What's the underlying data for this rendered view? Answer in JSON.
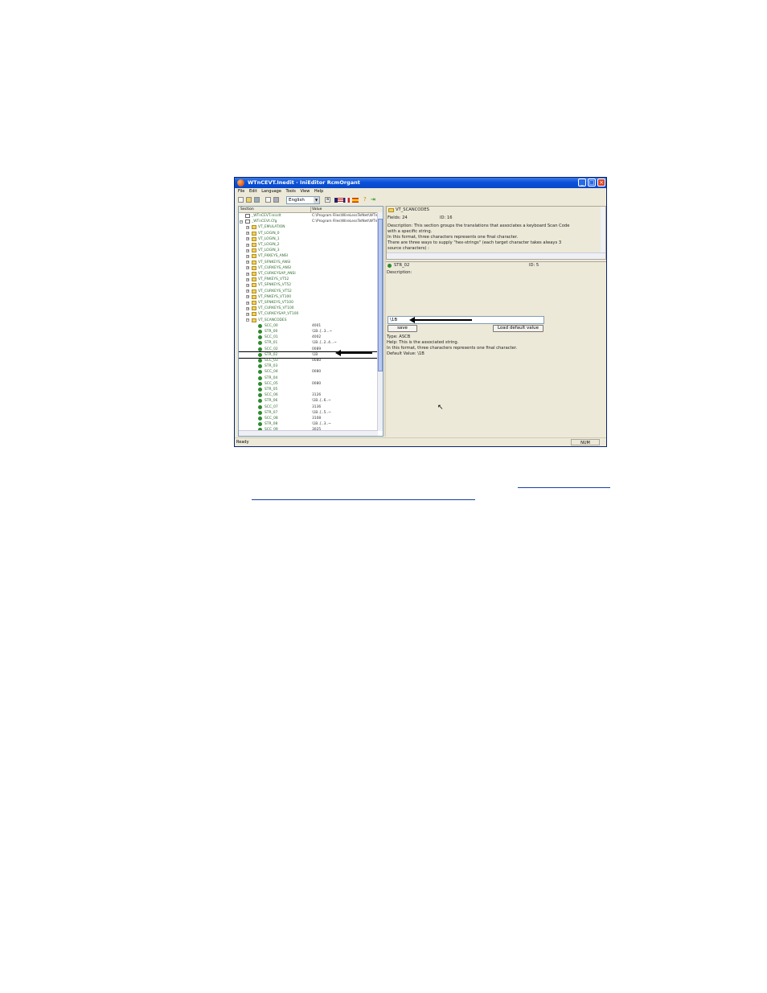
{
  "window": {
    "title": "WTnCEVT.Inedit - IniEditor RcmOrgant",
    "menu": [
      "File",
      "Edit",
      "Language",
      "Tools",
      "View",
      "Help"
    ],
    "language": "English"
  },
  "tree": {
    "column_section": "Section",
    "column_value": "Value",
    "rows": [
      {
        "label": "_WTnCEVT.inicdt",
        "value": "C:\\Program Files\\WireLessTelNet\\WTn",
        "depth": 1,
        "icon": "doc",
        "expander": ""
      },
      {
        "label": "_WTnCEVt.Cfg",
        "value": "C:\\Program Files\\WireLessTelNet\\WTn",
        "depth": 1,
        "icon": "doc",
        "expander": "−"
      },
      {
        "label": "VT_EMULATION",
        "value": "",
        "depth": 2,
        "icon": "folder",
        "expander": "+"
      },
      {
        "label": "VT_LOGIN_0",
        "value": "",
        "depth": 2,
        "icon": "folder",
        "expander": "+"
      },
      {
        "label": "VT_LOGIN_1",
        "value": "",
        "depth": 2,
        "icon": "folder",
        "expander": "+"
      },
      {
        "label": "VT_LOGIN_2",
        "value": "",
        "depth": 2,
        "icon": "folder",
        "expander": "+"
      },
      {
        "label": "VT_LOGIN_3",
        "value": "",
        "depth": 2,
        "icon": "folder",
        "expander": "+"
      },
      {
        "label": "VT_FKKEYS_ANSI",
        "value": "",
        "depth": 2,
        "icon": "folder",
        "expander": "+"
      },
      {
        "label": "VT_SFNKEYS_ANSI",
        "value": "",
        "depth": 2,
        "icon": "folder",
        "expander": "+"
      },
      {
        "label": "VT_CURKEYS_ANSI",
        "value": "",
        "depth": 2,
        "icon": "folder",
        "expander": "+"
      },
      {
        "label": "VT_CURKEYSAP_ANSI",
        "value": "",
        "depth": 2,
        "icon": "folder",
        "expander": "+"
      },
      {
        "label": "VT_FNKEYS_VT52",
        "value": "",
        "depth": 2,
        "icon": "folder",
        "expander": "+"
      },
      {
        "label": "VT_SFNKEYS_VT52",
        "value": "",
        "depth": 2,
        "icon": "folder",
        "expander": "+"
      },
      {
        "label": "VT_CURKEYS_VT52",
        "value": "",
        "depth": 2,
        "icon": "folder",
        "expander": "+"
      },
      {
        "label": "VT_FNKEYS_VT100",
        "value": "",
        "depth": 2,
        "icon": "folder",
        "expander": "+"
      },
      {
        "label": "VT_SFNKEYS_VT100",
        "value": "",
        "depth": 2,
        "icon": "folder",
        "expander": "+"
      },
      {
        "label": "VT_CURKEYS_VT100",
        "value": "",
        "depth": 2,
        "icon": "folder",
        "expander": "+"
      },
      {
        "label": "VT_CURKEYSAP_VT100",
        "value": "",
        "depth": 2,
        "icon": "folder",
        "expander": "+"
      },
      {
        "label": "VT_SCANCODES",
        "value": "",
        "depth": 2,
        "icon": "folder",
        "expander": "−"
      },
      {
        "label": "SCC_00",
        "value": "4001",
        "depth": 3,
        "icon": "key",
        "expander": ""
      },
      {
        "label": "STR_00",
        "value": "\\1B..[..3...~",
        "depth": 3,
        "icon": "key",
        "expander": ""
      },
      {
        "label": "SCC_01",
        "value": "4002",
        "depth": 3,
        "icon": "key",
        "expander": ""
      },
      {
        "label": "STR_01",
        "value": "\\1B..[..2..4...~",
        "depth": 3,
        "icon": "key",
        "expander": ""
      },
      {
        "label": "SCC_02",
        "value": "0089",
        "depth": 3,
        "icon": "key",
        "expander": ""
      },
      {
        "label": "STR_02",
        "value": "\\1B",
        "depth": 3,
        "icon": "key",
        "expander": "",
        "selected": true
      },
      {
        "label": "SCC_03",
        "value": "0080",
        "depth": 3,
        "icon": "key",
        "expander": ""
      },
      {
        "label": "STR_03",
        "value": "",
        "depth": 3,
        "icon": "key",
        "expander": ""
      },
      {
        "label": "SCC_04",
        "value": "0080",
        "depth": 3,
        "icon": "key",
        "expander": ""
      },
      {
        "label": "STR_04",
        "value": "",
        "depth": 3,
        "icon": "key",
        "expander": ""
      },
      {
        "label": "SCC_05",
        "value": "0080",
        "depth": 3,
        "icon": "key",
        "expander": ""
      },
      {
        "label": "STR_05",
        "value": "",
        "depth": 3,
        "icon": "key",
        "expander": ""
      },
      {
        "label": "SCC_06",
        "value": "3126",
        "depth": 3,
        "icon": "key",
        "expander": ""
      },
      {
        "label": "STR_06",
        "value": "\\1B..[..6..~",
        "depth": 3,
        "icon": "key",
        "expander": ""
      },
      {
        "label": "SCC_07",
        "value": "3136",
        "depth": 3,
        "icon": "key",
        "expander": ""
      },
      {
        "label": "STR_07",
        "value": "\\1B..[..5..~",
        "depth": 3,
        "icon": "key",
        "expander": ""
      },
      {
        "label": "SCC_08",
        "value": "3108",
        "depth": 3,
        "icon": "key",
        "expander": ""
      },
      {
        "label": "STR_08",
        "value": "\\1B..[..3..~",
        "depth": 3,
        "icon": "key",
        "expander": ""
      },
      {
        "label": "SCC_09",
        "value": "3025",
        "depth": 3,
        "icon": "key",
        "expander": ""
      }
    ]
  },
  "section_info": {
    "name": "VT_SCANCODES",
    "fields": "Fields: 24",
    "id": "ID: 16",
    "description_lines": [
      "Description: This section groups the translations that associates a keyboard Scan Code",
      "with a specific string.",
      "In this format, three characters represents one final character.",
      "There are three ways to supply \"hex-strings\" (each target character takes always 3",
      "source characters) :"
    ]
  },
  "key_info": {
    "name": "STR_02",
    "id": "ID: 5",
    "description": "Description:",
    "value": "\\1B",
    "save_label": "save",
    "load_default_label": "Load default value",
    "type": "Type: ASCB",
    "help": "Help: This is the associated string.",
    "help_line2": "In this format, three characters represents one final character.",
    "default_value": "Default Value: \\1B"
  },
  "status": {
    "left": "Ready",
    "num": "NUM"
  }
}
